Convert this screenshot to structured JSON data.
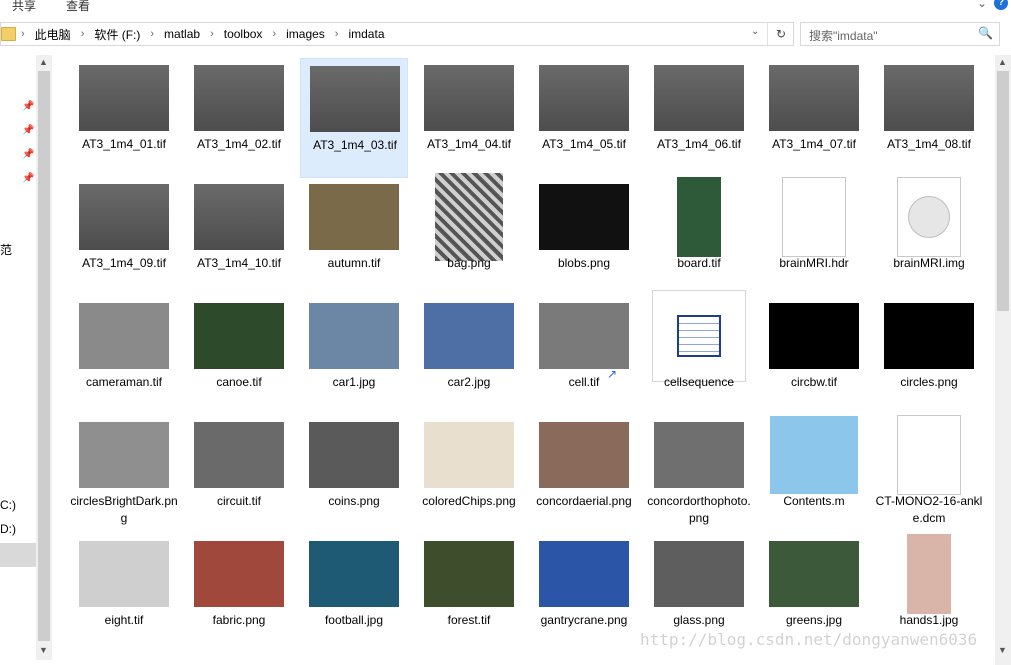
{
  "ribbon": {
    "share": "共享",
    "view": "查看",
    "help": "?"
  },
  "address": {
    "crumbs": [
      "此电脑",
      "软件 (F:)",
      "matlab",
      "toolbox",
      "images",
      "imdata"
    ],
    "search_placeholder": "搜索\"imdata\"",
    "dropdown_icon": "chevron-down-icon",
    "refresh_icon": "refresh-icon"
  },
  "nav": {
    "drive_c": "C:)",
    "drive_d": "D:)",
    "left_char": "范"
  },
  "files": [
    {
      "name": "AT3_1m4_01.tif",
      "thumb": "gray-cells",
      "color": "#5a5a5a"
    },
    {
      "name": "AT3_1m4_02.tif",
      "thumb": "gray-cells",
      "color": "#5a5a5a"
    },
    {
      "name": "AT3_1m4_03.tif",
      "thumb": "gray-cells",
      "color": "#5a5a5a"
    },
    {
      "name": "AT3_1m4_04.tif",
      "thumb": "gray-cells",
      "color": "#5a5a5a"
    },
    {
      "name": "AT3_1m4_05.tif",
      "thumb": "gray-cells",
      "color": "#5a5a5a"
    },
    {
      "name": "AT3_1m4_06.tif",
      "thumb": "gray-cells",
      "color": "#5a5a5a"
    },
    {
      "name": "AT3_1m4_07.tif",
      "thumb": "gray-cells",
      "color": "#5a5a5a"
    },
    {
      "name": "AT3_1m4_08.tif",
      "thumb": "gray-cells",
      "color": "#5a5a5a"
    },
    {
      "name": "AT3_1m4_09.tif",
      "thumb": "gray-cells",
      "color": "#5a5a5a"
    },
    {
      "name": "AT3_1m4_10.tif",
      "thumb": "gray-cells",
      "color": "#5a5a5a"
    },
    {
      "name": "autumn.tif",
      "thumb": "photo",
      "color": "#7a6a4a"
    },
    {
      "name": "bag.png",
      "thumb": "texture",
      "color": "#777777"
    },
    {
      "name": "blobs.png",
      "thumb": "bw",
      "color": "#111111"
    },
    {
      "name": "board.tif",
      "thumb": "photo-tall",
      "color": "#2f5a3a"
    },
    {
      "name": "brainMRI.hdr",
      "thumb": "doc",
      "color": "#ffffff"
    },
    {
      "name": "brainMRI.img",
      "thumb": "disc",
      "color": "#ffffff"
    },
    {
      "name": "cameraman.tif",
      "thumb": "photo",
      "color": "#8a8a8a"
    },
    {
      "name": "canoe.tif",
      "thumb": "photo",
      "color": "#2d4a2a"
    },
    {
      "name": "car1.jpg",
      "thumb": "photo",
      "color": "#6c87a6"
    },
    {
      "name": "car2.jpg",
      "thumb": "photo",
      "color": "#4d6fa5"
    },
    {
      "name": "cell.tif",
      "thumb": "photo",
      "color": "#7a7a7a"
    },
    {
      "name": "cellsequence",
      "thumb": "shortcut",
      "color": "#ffffff"
    },
    {
      "name": "circbw.tif",
      "thumb": "bw",
      "color": "#000000"
    },
    {
      "name": "circles.png",
      "thumb": "bw",
      "color": "#000000"
    },
    {
      "name": "circlesBrightDark.png",
      "thumb": "photo",
      "color": "#8f8f8f"
    },
    {
      "name": "circuit.tif",
      "thumb": "photo",
      "color": "#6a6a6a"
    },
    {
      "name": "coins.png",
      "thumb": "photo",
      "color": "#5a5a5a"
    },
    {
      "name": "coloredChips.png",
      "thumb": "photo",
      "color": "#e9dfcf"
    },
    {
      "name": "concordaerial.png",
      "thumb": "photo",
      "color": "#8a6a5a"
    },
    {
      "name": "concordorthophoto.png",
      "thumb": "photo",
      "color": "#6f6f6f"
    },
    {
      "name": "Contents.m",
      "thumb": "notepad",
      "color": "#8cc6ea"
    },
    {
      "name": "CT-MONO2-16-ankle.dcm",
      "thumb": "doc",
      "color": "#ffffff"
    },
    {
      "name": "eight.tif",
      "thumb": "photo",
      "color": "#cfcfcf"
    },
    {
      "name": "fabric.png",
      "thumb": "photo",
      "color": "#a0483c"
    },
    {
      "name": "football.jpg",
      "thumb": "photo",
      "color": "#1e5a73"
    },
    {
      "name": "forest.tif",
      "thumb": "photo",
      "color": "#3e4e2d"
    },
    {
      "name": "gantrycrane.png",
      "thumb": "photo",
      "color": "#2b55a6"
    },
    {
      "name": "glass.png",
      "thumb": "photo",
      "color": "#5e5e5e"
    },
    {
      "name": "greens.jpg",
      "thumb": "photo",
      "color": "#3c5a3a"
    },
    {
      "name": "hands1.jpg",
      "thumb": "photo-tall",
      "color": "#d9b4a8"
    }
  ],
  "selected_index": 2,
  "watermark": "http://blog.csdn.net/dongyanwen6036"
}
